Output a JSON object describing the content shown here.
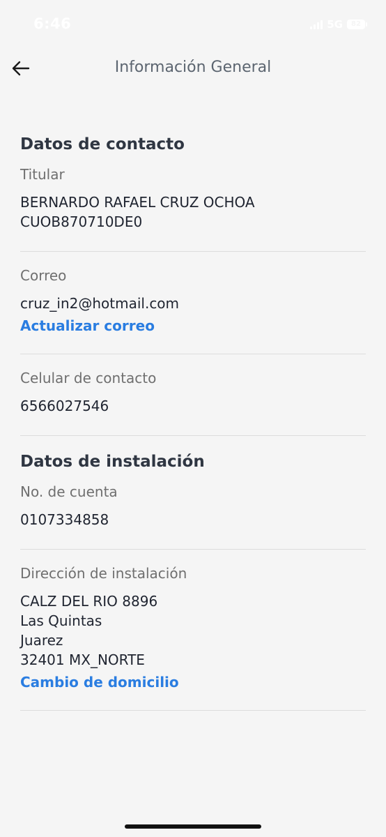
{
  "status_bar": {
    "time": "6:46",
    "network": "5G",
    "battery": "82"
  },
  "header": {
    "title": "Información General",
    "back_icon": "arrow-left-icon"
  },
  "contact_section": {
    "title": "Datos de contacto",
    "holder_label": "Titular",
    "holder_value": "BERNARDO RAFAEL CRUZ OCHOA\nCUOB870710DE0",
    "email_label": "Correo",
    "email_value": "cruz_in2@hotmail.com",
    "email_link": "Actualizar correo",
    "phone_label": "Celular de contacto",
    "phone_value": "6566027546"
  },
  "installation_section": {
    "title": "Datos de instalación",
    "account_label": "No. de cuenta",
    "account_value": "0107334858",
    "address_label": "Dirección de instalación",
    "address_value": "CALZ DEL RIO 8896\nLas Quintas\nJuarez\n32401 MX_NORTE",
    "address_link": "Cambio de domicilio"
  },
  "colors": {
    "background": "#f5f5f5",
    "link": "#2a7de1",
    "title": "#2f3642",
    "label": "#6f6f6f"
  }
}
